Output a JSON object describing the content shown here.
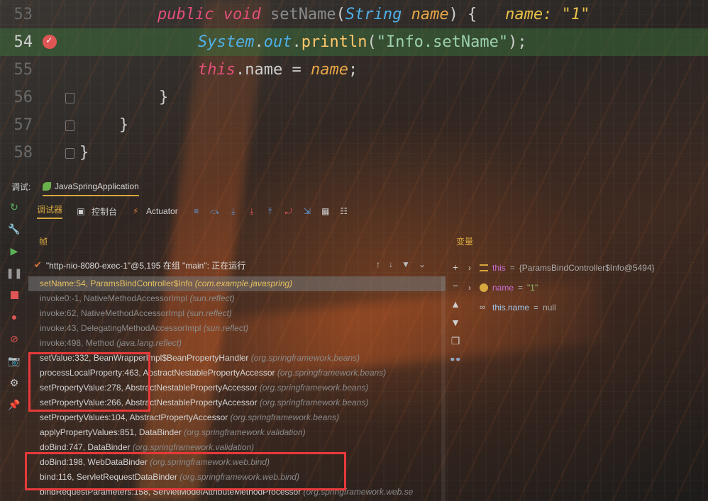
{
  "editor": {
    "lines": [
      {
        "num": "53",
        "tokens": [
          {
            "t": "public ",
            "c": "kw2"
          },
          {
            "t": "void ",
            "c": "kw2"
          },
          {
            "t": "setName",
            "c": "dim"
          },
          {
            "t": "(",
            "c": "plain"
          },
          {
            "t": "String ",
            "c": "type"
          },
          {
            "t": "name",
            "c": "param"
          },
          {
            "t": ") {   ",
            "c": "plain"
          },
          {
            "t": "name: \"1\"",
            "c": "inline"
          }
        ]
      },
      {
        "num": "54",
        "tokens": [
          {
            "t": "System",
            "c": "type"
          },
          {
            "t": ".",
            "c": "plain"
          },
          {
            "t": "out",
            "c": "type"
          },
          {
            "t": ".",
            "c": "plain"
          },
          {
            "t": "println",
            "c": "fn"
          },
          {
            "t": "(",
            "c": "plain"
          },
          {
            "t": "\"Info.setName\"",
            "c": "strc"
          },
          {
            "t": ");",
            "c": "plain"
          }
        ]
      },
      {
        "num": "55",
        "tokens": [
          {
            "t": "this",
            "c": "kw2"
          },
          {
            "t": ".name ",
            "c": "plain"
          },
          {
            "t": "= ",
            "c": "plain"
          },
          {
            "t": "name",
            "c": "param"
          },
          {
            "t": ";",
            "c": "plain"
          }
        ]
      },
      {
        "num": "56",
        "tokens": [
          {
            "t": "}",
            "c": "plain"
          }
        ]
      },
      {
        "num": "57",
        "tokens": [
          {
            "t": "}",
            "c": "plain"
          }
        ]
      },
      {
        "num": "58",
        "tokens": [
          {
            "t": "}",
            "c": "plain"
          }
        ]
      }
    ]
  },
  "debug": {
    "label": "调试:",
    "run_tab": "JavaSpringApplication",
    "sub_tabs": [
      "调试器",
      "控制台",
      "Actuator"
    ],
    "frames_title": "帧",
    "vars_title": "变量",
    "thread": "\"http-nio-8080-exec-1\"@5,195 在组 \"main\": 正在运行",
    "frames": [
      {
        "m": "setName:54, ParamsBindController$Info",
        "p": "(com.example.javaspring)"
      },
      {
        "m": "invoke0:-1, NativeMethodAccessorImpl",
        "p": "(sun.reflect)"
      },
      {
        "m": "invoke:62, NativeMethodAccessorImpl",
        "p": "(sun.reflect)"
      },
      {
        "m": "invoke:43, DelegatingMethodAccessorImpl",
        "p": "(sun.reflect)"
      },
      {
        "m": "invoke:498, Method",
        "p": "(java.lang.reflect)"
      },
      {
        "m": "setValue:332, BeanWrapperImpl$BeanPropertyHandler",
        "p": "(org.springframework.beans)"
      },
      {
        "m": "processLocalProperty:463, AbstractNestablePropertyAccessor",
        "p": "(org.springframework.beans)"
      },
      {
        "m": "setPropertyValue:278, AbstractNestablePropertyAccessor",
        "p": "(org.springframework.beans)"
      },
      {
        "m": "setPropertyValue:266, AbstractNestablePropertyAccessor",
        "p": "(org.springframework.beans)"
      },
      {
        "m": "setPropertyValues:104, AbstractPropertyAccessor",
        "p": "(org.springframework.beans)"
      },
      {
        "m": "applyPropertyValues:851, DataBinder",
        "p": "(org.springframework.validation)"
      },
      {
        "m": "doBind:747, DataBinder",
        "p": "(org.springframework.validation)"
      },
      {
        "m": "doBind:198, WebDataBinder",
        "p": "(org.springframework.web.bind)"
      },
      {
        "m": "bind:116, ServletRequestDataBinder",
        "p": "(org.springframework.web.bind)"
      },
      {
        "m": "bindRequestParameters:158, ServletModelAttributeMethodProcessor",
        "p": "(org.springframework.web.se"
      }
    ],
    "variables": [
      {
        "name": "this",
        "val": "{ParamsBindController$Info@5494}",
        "kind": "obj"
      },
      {
        "name": "name",
        "val": "\"1\"",
        "kind": "param"
      },
      {
        "name": "this.name",
        "val": "null",
        "kind": "watch"
      }
    ]
  },
  "colors": {
    "accent": "#d6a840",
    "highlight": "#e8393a",
    "current_line": "#3c783c"
  }
}
